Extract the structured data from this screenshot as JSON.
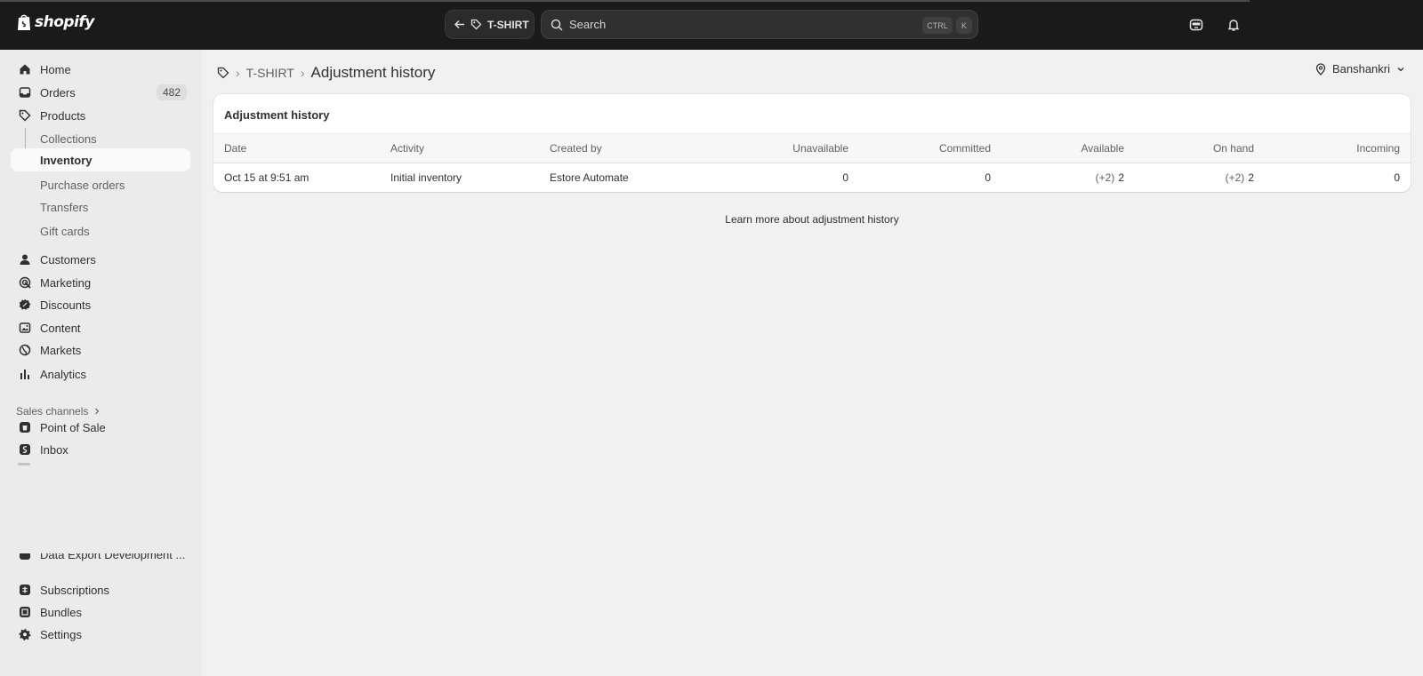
{
  "topbar": {
    "brand": "shopify",
    "back_label": "T-SHIRT",
    "search_placeholder": "Search",
    "shortcut_ctrl": "CTRL",
    "shortcut_k": "K"
  },
  "sidebar": {
    "items": [
      {
        "label": "Home",
        "icon": "home-icon"
      },
      {
        "label": "Orders",
        "icon": "orders-icon",
        "badge": "482"
      },
      {
        "label": "Products",
        "icon": "tag-icon"
      },
      {
        "label": "Collections"
      },
      {
        "label": "Inventory"
      },
      {
        "label": "Purchase orders"
      },
      {
        "label": "Transfers"
      },
      {
        "label": "Gift cards"
      },
      {
        "label": "Customers",
        "icon": "person-icon"
      },
      {
        "label": "Marketing",
        "icon": "target-icon"
      },
      {
        "label": "Discounts",
        "icon": "discount-icon"
      },
      {
        "label": "Content",
        "icon": "image-icon"
      },
      {
        "label": "Markets",
        "icon": "globe-icon"
      },
      {
        "label": "Analytics",
        "icon": "bar-chart-icon"
      }
    ],
    "sales_channels_label": "Sales channels",
    "apps": [
      {
        "label": "Point of Sale",
        "icon": "pos-app-icon"
      },
      {
        "label": "Inbox",
        "icon": "inbox-app-icon"
      },
      {
        "label": "Data Export Development ...",
        "icon": "app-icon"
      },
      {
        "label": "Subscriptions",
        "icon": "subscriptions-app-icon"
      },
      {
        "label": "Bundles",
        "icon": "bundles-app-icon"
      }
    ],
    "settings_label": "Settings"
  },
  "main": {
    "breadcrumb_product": "T-SHIRT",
    "title": "Adjustment history",
    "location": "Banshankri",
    "card_title": "Adjustment history",
    "columns": [
      "Date",
      "Activity",
      "Created by",
      "Unavailable",
      "Committed",
      "Available",
      "On hand",
      "Incoming"
    ],
    "rows": [
      {
        "date": "Oct 15 at 9:51 am",
        "activity": "Initial inventory",
        "created_by": "Estore Automate",
        "unavailable": "0",
        "committed": "0",
        "available_delta": "(+2)",
        "available": "2",
        "on_hand_delta": "(+2)",
        "on_hand": "2",
        "incoming": "0"
      }
    ],
    "learn_more": "Learn more about adjustment history"
  },
  "colors": {
    "topbar_bg": "#1a1a1a",
    "sidebar_bg": "#ebebeb",
    "main_bg": "#f1f1f1",
    "card_bg": "#ffffff"
  }
}
